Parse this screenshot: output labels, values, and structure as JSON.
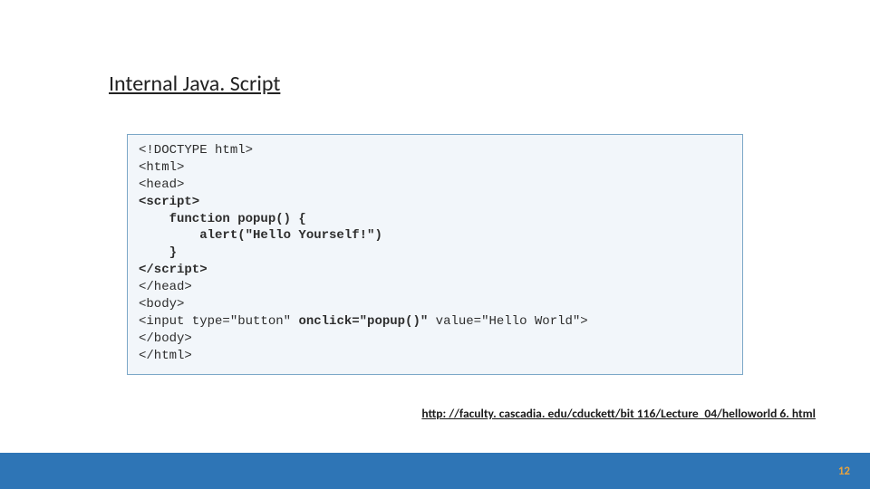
{
  "title": "Internal Java. Script",
  "code": {
    "l1": "<!DOCTYPE html>",
    "l2": "<html>",
    "l3": "<head>",
    "l4": "<script>",
    "l5": "    function popup() {",
    "l6": "        alert(\"Hello Yourself!\")",
    "l7": "    }",
    "l8": "</script>",
    "l9": "</head>",
    "l10": "<body>",
    "l11a": "<input type=\"button\" ",
    "l11b": "onclick=\"popup()\"",
    "l11c": " value=\"Hello World\">",
    "l12": "</body>",
    "l13": "</html>"
  },
  "link": "http: //faculty. cascadia. edu/cduckett/bit 116/Lecture_04/helloworld 6. html",
  "page_number": "12"
}
